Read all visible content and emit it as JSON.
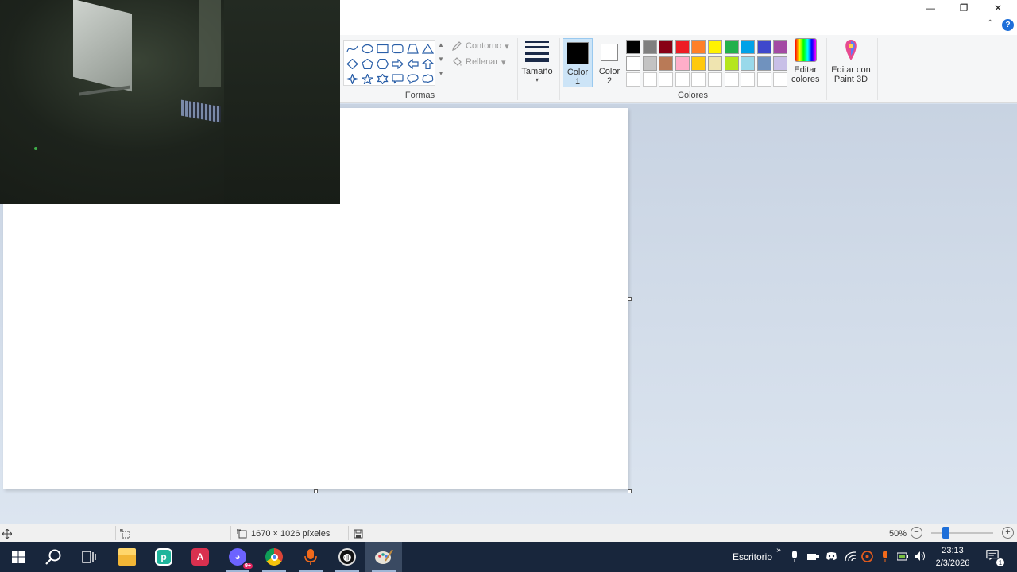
{
  "window": {
    "minimize_symbol": "—",
    "maximize_symbol": "❐",
    "close_symbol": "✕",
    "collapse_symbol": "⌃",
    "help_symbol": "?"
  },
  "ribbon": {
    "shapes": {
      "group_label": "Formas",
      "outline_label": "Contorno",
      "fill_label": "Rellenar"
    },
    "size_label": "Tamaño",
    "color1": {
      "line1": "Color",
      "line2": "1",
      "value": "#000000"
    },
    "color2": {
      "line1": "Color",
      "line2": "2",
      "value": "#ffffff"
    },
    "colors_group_label": "Colores",
    "edit_colors": {
      "line1": "Editar",
      "line2": "colores"
    },
    "paint3d": {
      "line1": "Editar con",
      "line2": "Paint 3D"
    },
    "palette_row1": [
      "#000000",
      "#7f7f7f",
      "#880015",
      "#ed1c24",
      "#ff7f27",
      "#fff200",
      "#22b14c",
      "#00a2e8",
      "#3f48cc",
      "#a349a4"
    ],
    "palette_row2": [
      "#ffffff",
      "#c3c3c3",
      "#b97a57",
      "#ffaec9",
      "#ffc90e",
      "#efe4b0",
      "#b5e61d",
      "#99d9ea",
      "#7092be",
      "#c8bfe7"
    ],
    "palette_row3": [
      "#ffffff",
      "#ffffff",
      "#ffffff",
      "#ffffff",
      "#ffffff",
      "#ffffff",
      "#ffffff",
      "#ffffff",
      "#ffffff",
      "#ffffff"
    ]
  },
  "statusbar": {
    "dimensions": "1670 × 1026 píxeles",
    "zoom": "50%",
    "zoom_level_percent": 50
  },
  "taskbar": {
    "desktop_label": "Escritorio",
    "time": "23:13",
    "date": "2/3/2026",
    "notification_count": "1",
    "discord_badge": "9+",
    "apps": [
      "start",
      "search",
      "task-view",
      "file-explorer",
      "app-green",
      "app-red",
      "discord",
      "chrome",
      "voice-recorder",
      "obs",
      "paint"
    ]
  }
}
